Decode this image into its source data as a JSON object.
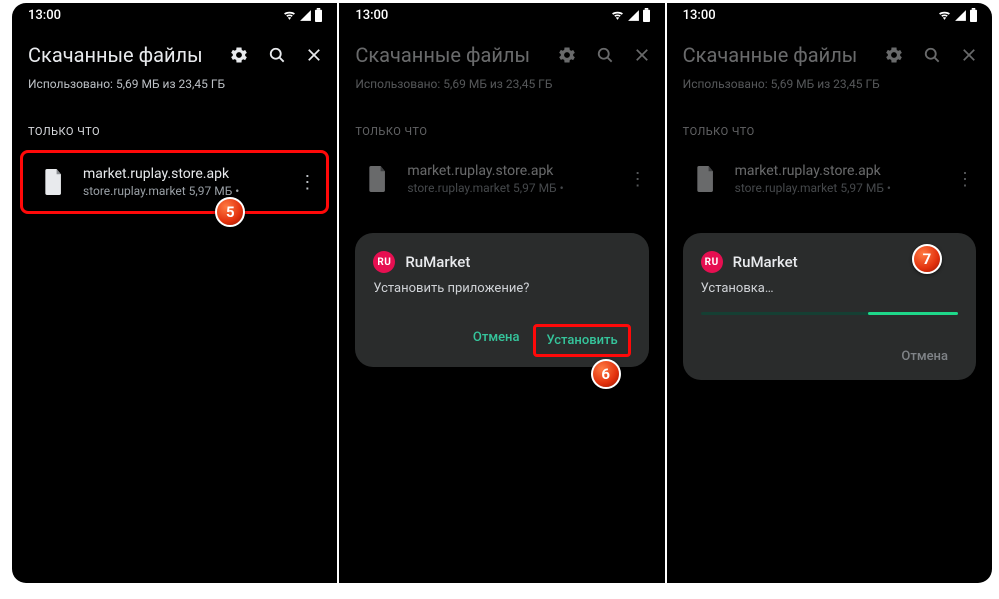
{
  "status": {
    "time": "13:00"
  },
  "header": {
    "title": "Скачанные файлы",
    "usage": "Использовано: 5,69 МБ из 23,45 ГБ"
  },
  "section": {
    "label": "ТОЛЬКО ЧТО"
  },
  "file": {
    "name": "market.ruplay.store.apk",
    "sub": "store.ruplay.market 5,97 МБ •"
  },
  "dialog_install": {
    "app_icon_text": "RU",
    "app": "RuMarket",
    "question": "Установить приложение?",
    "cancel": "Отмена",
    "install": "Установить"
  },
  "dialog_progress": {
    "app_icon_text": "RU",
    "app": "RuMarket",
    "status": "Установка…",
    "cancel": "Отмена"
  },
  "annot": {
    "a5": "5",
    "a6": "6",
    "a7": "7"
  }
}
